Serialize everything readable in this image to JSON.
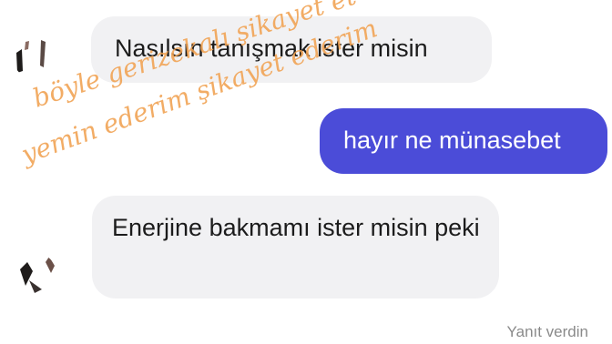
{
  "messages": [
    {
      "direction": "incoming",
      "text": "Nasılsın tanışmak ister misin"
    },
    {
      "direction": "outgoing",
      "text": "hayır ne münasebet"
    },
    {
      "direction": "incoming",
      "text": "Enerjine bakmamı ister misin peki"
    }
  ],
  "status": {
    "text": "Yanıt verdin"
  },
  "watermark": {
    "line1": "böyle gerizekalı şikayet et",
    "line2": "yemin ederim şikayet ederim"
  },
  "colors": {
    "incoming_bubble": "#f1f1f3",
    "outgoing_bubble": "#4b4cd8",
    "watermark": "#f0a050"
  }
}
